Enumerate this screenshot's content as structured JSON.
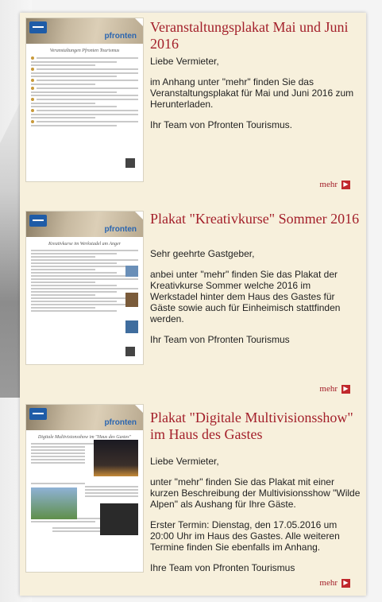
{
  "brand": "pfronten",
  "more_label": "mehr",
  "entries": [
    {
      "title": "Veranstaltungsplakat Mai und Juni 2016",
      "thumb_caption": "Veranstaltungen Pfronten Tourismus",
      "paragraphs": [
        "Liebe Vermieter,",
        "im Anhang unter \"mehr\" finden Sie das Veranstaltungsplakat für Mai und Juni 2016 zum Herunterladen.",
        "Ihr Team von Pfronten Tourismus."
      ]
    },
    {
      "title": "Plakat \"Kreativkurse\" Sommer 2016",
      "thumb_caption": "Kreativkurse im Werkstadel am Anger",
      "paragraphs": [
        "Sehr geehrte Gastgeber,",
        "anbei unter \"mehr\" finden Sie das Plakat der Kreativkurse Sommer welche 2016 im Werkstadel hinter dem Haus des Gastes für Gäste sowie auch für Einheimisch stattfinden werden.",
        "Ihr Team von Pfronten Tourismus"
      ]
    },
    {
      "title": "Plakat \"Digitale Multivisionsshow\" im Haus des Gastes",
      "thumb_caption": "Digitale Multivisionsshow im \"Haus des Gastes\"",
      "paragraphs": [
        "Liebe Vermieter,",
        "unter \"mehr\" finden Sie das Plakat mit einer kurzen Beschreibung der Multivisionsshow \"Wilde Alpen\" als Aushang für Ihre Gäste.",
        "Erster Termin: Dienstag, den 17.05.2016 um 20:00 Uhr im Haus des Gastes. Alle weiteren Termine finden Sie ebenfalls im Anhang.",
        "Ihre Team von Pfronten Tourismus"
      ]
    }
  ]
}
